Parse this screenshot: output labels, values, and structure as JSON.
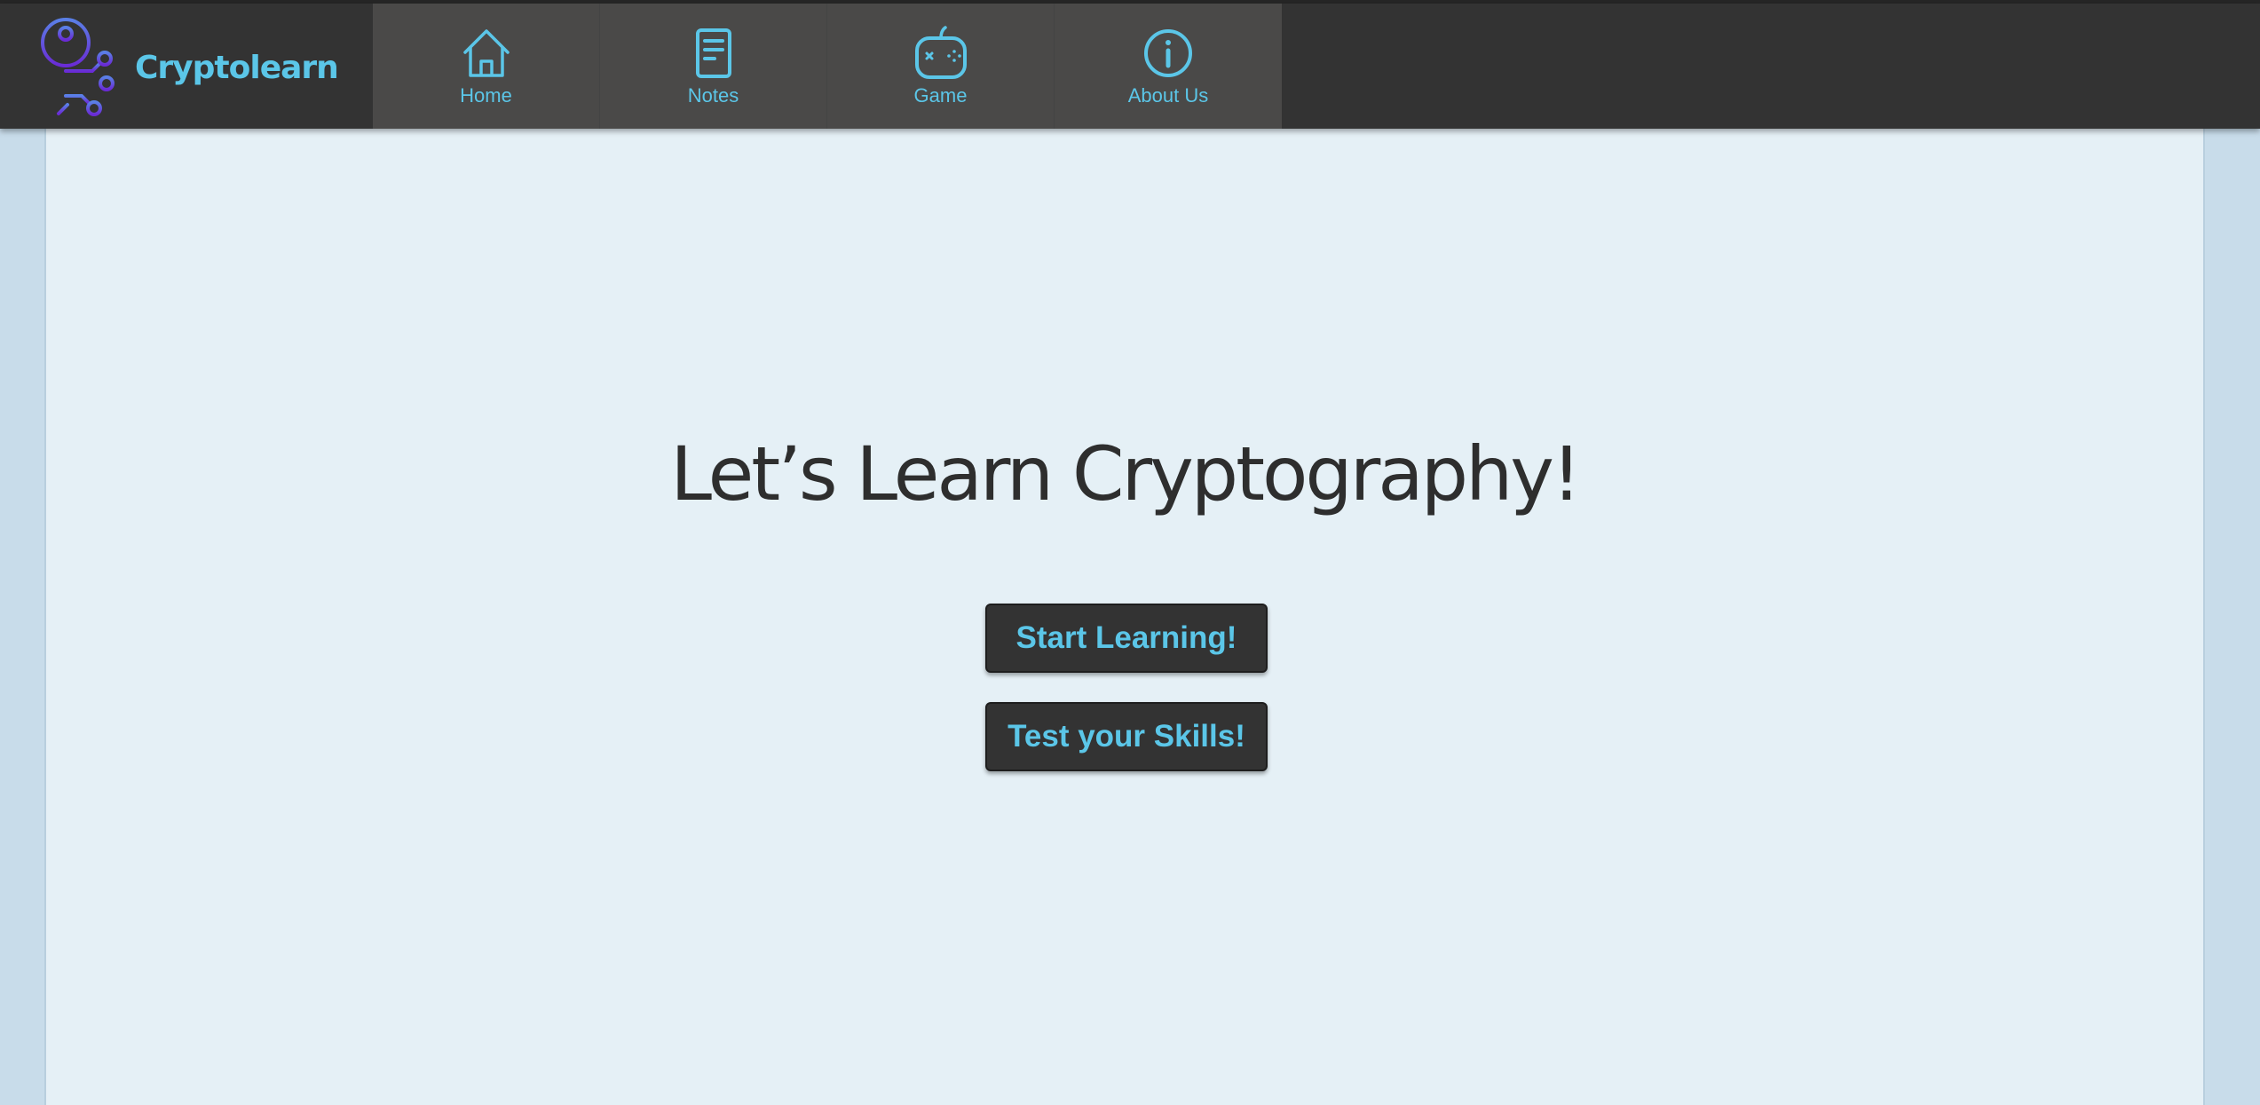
{
  "brand": {
    "name": "Cryptolearn",
    "logo_icon": "key-circuit-icon"
  },
  "nav": {
    "items": [
      {
        "label": "Home",
        "icon": "home-icon"
      },
      {
        "label": "Notes",
        "icon": "notes-icon"
      },
      {
        "label": "Game",
        "icon": "gamepad-icon"
      },
      {
        "label": "About Us",
        "icon": "info-icon"
      }
    ]
  },
  "hero": {
    "title": "Let’s Learn Cryptography!",
    "start_label": "Start Learning!",
    "test_label": "Test your Skills!"
  },
  "colors": {
    "accent": "#5bc6e8",
    "navbar_bg": "#333333",
    "nav_group_bg": "#4a4948",
    "content_bg": "#e5f0f6",
    "page_bg": "#c8dcea",
    "logo_gradient_start": "#5a6fe0",
    "logo_gradient_end": "#6a2bd6"
  }
}
